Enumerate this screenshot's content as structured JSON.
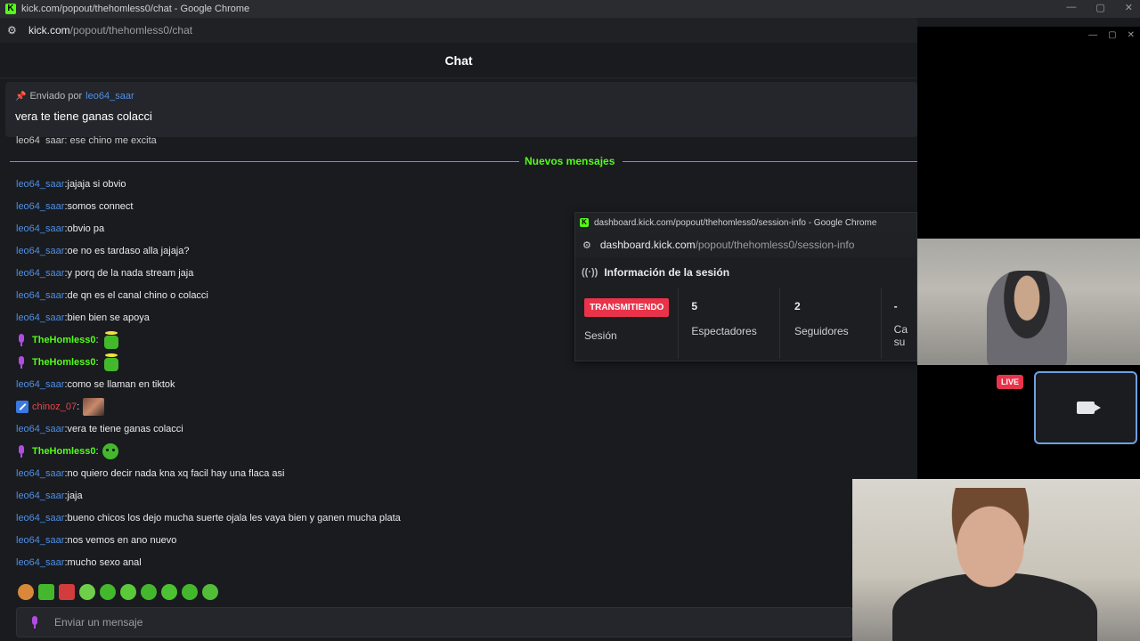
{
  "window": {
    "title": "kick.com/popout/thehomless0/chat - Google Chrome",
    "logo_letter": "K",
    "minimize": "—",
    "restore": "▢",
    "close": "✕"
  },
  "address": {
    "host": "kick.com",
    "path": "/popout/thehomless0/chat"
  },
  "chat": {
    "title": "Chat",
    "pinned": {
      "sent_by_label": "Enviado por",
      "user": "leo64_saar",
      "message": "vera te tiene ganas colacci"
    },
    "cut_message": "leo64_saar: ese chino me excita",
    "new_messages_label": "Nuevos mensajes",
    "messages": [
      {
        "user": "leo64_saar",
        "text": "jajaja si obvio"
      },
      {
        "user": "leo64_saar",
        "text": "somos connect"
      },
      {
        "user": "leo64_saar",
        "text": "obvio pa"
      },
      {
        "user": "leo64_saar",
        "text": "oe no es tardaso alla jajaja?"
      },
      {
        "user": "leo64_saar",
        "text": "y porq de la nada stream jaja"
      },
      {
        "user": "leo64_saar",
        "text": "de qn es el canal chino o colacci"
      },
      {
        "user": "leo64_saar",
        "text": "bien bien se apoya"
      },
      {
        "user": "TheHomless0",
        "text": ""
      },
      {
        "user": "TheHomless0",
        "text": ""
      },
      {
        "user": "leo64_saar",
        "text": "como se llaman en tiktok"
      },
      {
        "user": "chinoz_07",
        "text": ""
      },
      {
        "user": "leo64_saar",
        "text": "vera te tiene ganas colacci"
      },
      {
        "user": "TheHomless0",
        "text": ""
      },
      {
        "user": "leo64_saar",
        "text": "no quiero decir nada kna xq facil hay una flaca asi"
      },
      {
        "user": "leo64_saar",
        "text": "jaja"
      },
      {
        "user": "leo64_saar",
        "text": "bueno chicos los dejo mucha suerte ojala les vaya bien y ganen mucha plata"
      },
      {
        "user": "leo64_saar",
        "text": "nos vemos en ano nuevo"
      },
      {
        "user": "leo64_saar",
        "text": "mucho sexo anal"
      }
    ],
    "separator": ": ",
    "input_placeholder": "Enviar un mensaje"
  },
  "session_popup": {
    "title": "dashboard.kick.com/popout/thehomless0/session-info - Google Chrome",
    "host": "dashboard.kick.com",
    "path": "/popout/thehomless0/session-info",
    "heading": "Información de la sesión",
    "status_tag": "TRANSMITIENDO",
    "session_label": "Sesión",
    "viewers_value": "5",
    "viewers_label": "Espectadores",
    "followers_value": "2",
    "followers_label": "Seguidores",
    "extra_value": "-",
    "extra_label_1": "Ca",
    "extra_label_2": "su"
  },
  "stream": {
    "live_badge": "LIVE"
  },
  "colors": {
    "accent_green": "#53fc18",
    "username_blue": "#4f8fe6",
    "live_red": "#e8334a",
    "background": "#191b1f"
  }
}
